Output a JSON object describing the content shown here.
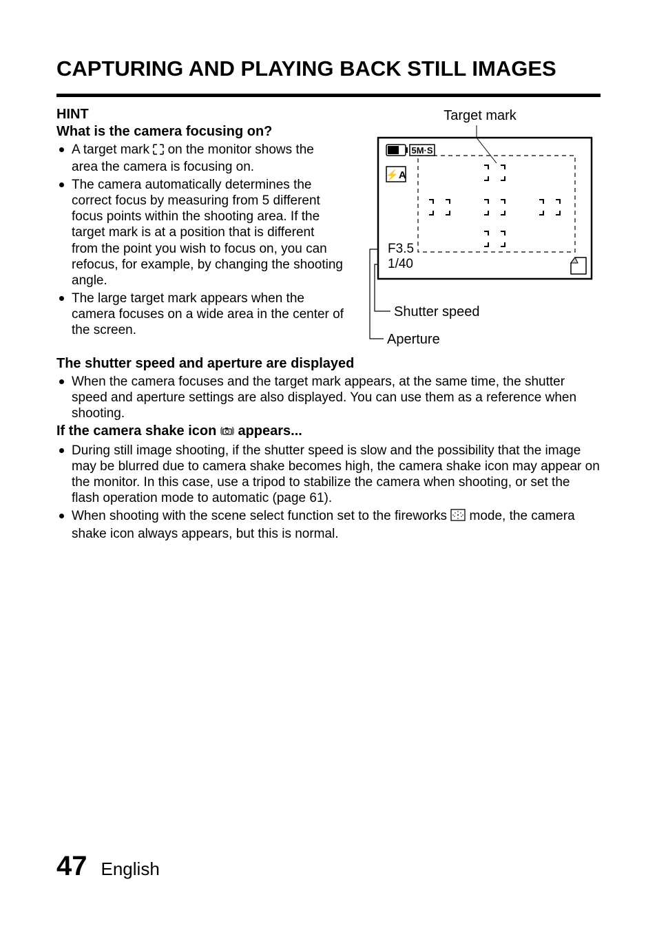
{
  "title": "CAPTURING AND PLAYING BACK STILL IMAGES",
  "hint": "HINT",
  "q1": "What is the camera focusing on?",
  "b1": "A target mark",
  "b1b": "on the monitor shows the area the camera is focusing on.",
  "b2": "The camera automatically determines the correct focus by measuring from 5 different focus points within the shooting area. If the target mark is at a position that is different from the point you wish to focus on, you can refocus, for example, by changing the shooting angle.",
  "b3": "The large target mark appears when the camera focuses on a wide area in the center of the screen.",
  "q2": "The shutter speed and aperture are displayed",
  "b4": "When the camera focuses and the target mark appears, at the same time, the shutter speed and aperture settings are also displayed. You can use them as a reference when shooting.",
  "q3a": "If the camera shake icon",
  "q3b": "appears...",
  "b5": "During still image shooting, if the shutter speed is slow and the possibility that the image may be blurred due to camera shake becomes high, the camera shake icon may appear on the monitor. In this case, use a tripod to stabilize the camera when shooting, or set the flash operation mode to automatic (page 61).",
  "b6a": "When shooting with the scene select function set to the fireworks",
  "b6b": "mode, the camera shake icon always appears, but this is normal.",
  "diagram": {
    "targetMark": "Target mark",
    "shutterSpeed": "Shutter speed",
    "aperture": "Aperture",
    "apertureVal": "F3.5",
    "shutterVal": "1/40",
    "resIcon": "5M·S",
    "flashIcon": "⚡A"
  },
  "footer": {
    "page": "47",
    "lang": "English"
  }
}
